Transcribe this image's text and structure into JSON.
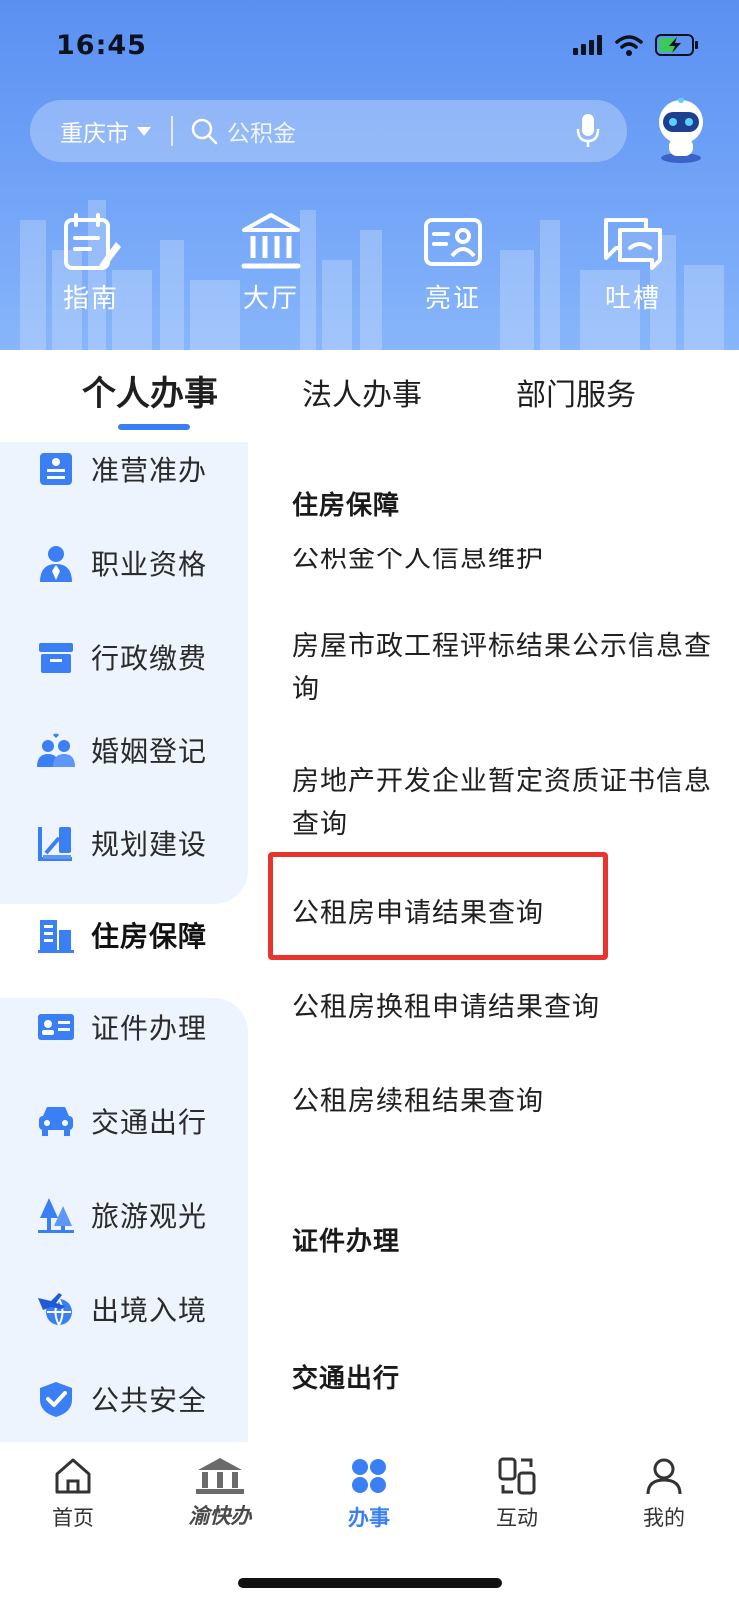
{
  "status_bar": {
    "time": "16:45"
  },
  "search": {
    "city": "重庆市",
    "placeholder": "公积金"
  },
  "quick_actions": [
    {
      "label": "指南",
      "icon": "guide-icon"
    },
    {
      "label": "大厅",
      "icon": "hall-icon"
    },
    {
      "label": "亮证",
      "icon": "id-card-icon"
    },
    {
      "label": "吐槽",
      "icon": "feedback-icon"
    }
  ],
  "tabs": [
    {
      "label": "个人办事",
      "active": true
    },
    {
      "label": "法人办事",
      "active": false
    },
    {
      "label": "部门服务",
      "active": false
    }
  ],
  "side_nav": [
    {
      "label": "准营准办",
      "icon": "license-icon"
    },
    {
      "label": "职业资格",
      "icon": "worker-icon"
    },
    {
      "label": "行政缴费",
      "icon": "payment-box-icon"
    },
    {
      "label": "婚姻登记",
      "icon": "couple-icon"
    },
    {
      "label": "规划建设",
      "icon": "planning-icon"
    },
    {
      "label": "住房保障",
      "icon": "building-icon",
      "active": true
    },
    {
      "label": "证件办理",
      "icon": "id-document-icon"
    },
    {
      "label": "交通出行",
      "icon": "car-icon"
    },
    {
      "label": "旅游观光",
      "icon": "trees-icon"
    },
    {
      "label": "出境入境",
      "icon": "plane-globe-icon"
    },
    {
      "label": "公共安全",
      "icon": "shield-check-icon"
    }
  ],
  "content": {
    "sections": [
      {
        "title": "住房保障",
        "items": [
          "公积金个人信息维护",
          "房屋市政工程评标结果公示信息查询",
          "房地产开发企业暂定资质证书信息查询",
          "公租房申请结果查询",
          "公租房换租申请结果查询",
          "公租房续租结果查询"
        ]
      },
      {
        "title": "证件办理",
        "items": []
      },
      {
        "title": "交通出行",
        "items": []
      }
    ],
    "highlighted_item": "公租房申请结果查询",
    "highlight_color": "#e8342c"
  },
  "bottom_nav": [
    {
      "label": "首页",
      "icon": "home-icon"
    },
    {
      "label": "渝快办",
      "icon": "brand-logo-icon"
    },
    {
      "label": "办事",
      "icon": "services-grid-icon",
      "active": true
    },
    {
      "label": "互动",
      "icon": "interaction-icon"
    },
    {
      "label": "我的",
      "icon": "profile-icon"
    }
  ],
  "colors": {
    "primary": "#3b7ff5",
    "header_top": "#5b90f2",
    "side_bg": "#eef4fe"
  }
}
